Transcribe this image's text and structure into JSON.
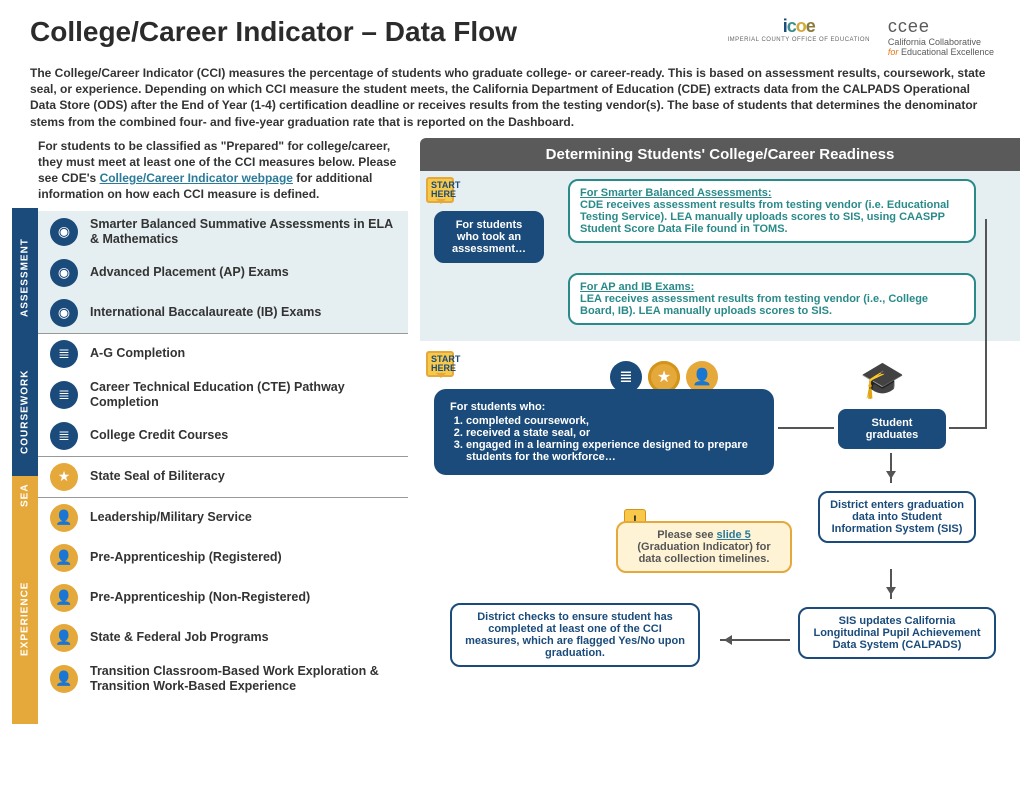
{
  "title": "College/Career Indicator – Data Flow",
  "logos": {
    "icoe_sub": "IMPERIAL COUNTY OFFICE OF EDUCATION",
    "ccee_top": "ccee",
    "ccee_sub1": "California Collaborative",
    "ccee_sub2_for": "for",
    "ccee_sub2_rest": " Educational Excellence"
  },
  "intro": "The College/Career Indicator (CCI) measures the percentage of students who graduate college- or career-ready. This is based on assessment results, coursework, state seal, or experience. Depending on which CCI measure the student meets, the California Department of Education (CDE) extracts data from the CALPADS Operational Data Store (ODS) after the End of Year (1-4) certification deadline or receives results from the testing vendor(s). The base of students that determines the denominator stems from the combined four- and five-year graduation rate that is reported on the Dashboard.",
  "left_intro_1": "For students to be classified as \"Prepared\" for college/career, they must meet at least one of the CCI measures below. Please see CDE's ",
  "left_intro_link": "College/Career Indicator webpage",
  "left_intro_2": " for additional information on how each CCI measure is defined.",
  "categories": {
    "assessment": {
      "label": "ASSESSMENT",
      "items": [
        "Smarter Balanced Summative Assessments in ELA & Mathematics",
        "Advanced Placement (AP) Exams",
        "International Baccalaureate (IB) Exams"
      ]
    },
    "coursework": {
      "label": "COURSEWORK",
      "items": [
        "A-G Completion",
        "Career Technical Education (CTE) Pathway Completion",
        "College Credit Courses"
      ]
    },
    "seal": {
      "label": "SEA",
      "items": [
        "State Seal of Biliteracy"
      ]
    },
    "experience": {
      "label": "EXPERIENCE",
      "items": [
        "Leadership/Military Service",
        "Pre-Apprenticeship (Registered)",
        "Pre-Apprenticeship (Non-Registered)",
        "State & Federal Job Programs",
        "Transition Classroom-Based Work Exploration & Transition Work-Based Experience"
      ]
    }
  },
  "det_header": "Determining Students' College/Career Readiness",
  "start_here": "START HERE",
  "flow": {
    "assess_start": "For students who took an assessment…",
    "sba_title": "For Smarter Balanced Assessments:",
    "sba_body": "CDE receives assessment results from testing vendor (i.e. Educational Testing Service). LEA manually uploads scores to SIS, using CAASPP Student Score Data File found in TOMS.",
    "ap_title": "For AP and IB Exams:",
    "ap_body": "LEA receives assessment results from testing vendor (i.e., College Board, IB). LEA manually uploads scores to SIS.",
    "cw_start": "For students who:",
    "cw_1": "completed coursework,",
    "cw_2": "received a state seal, or",
    "cw_3": "engaged in a learning experience designed to prepare students for the workforce…",
    "graduates": "Student graduates",
    "district_enters": "District enters graduation data into Student Information System (SIS)",
    "sis_updates": "SIS updates California Longitudinal Pupil Achievement Data System (CALPADS)",
    "district_checks": "District checks to ensure student has completed at least one of the CCI measures, which are flagged Yes/No upon graduation.",
    "warn_1": "Please see ",
    "warn_link": "slide 5",
    "warn_2": " (Graduation Indicator) for data collection timelines."
  }
}
